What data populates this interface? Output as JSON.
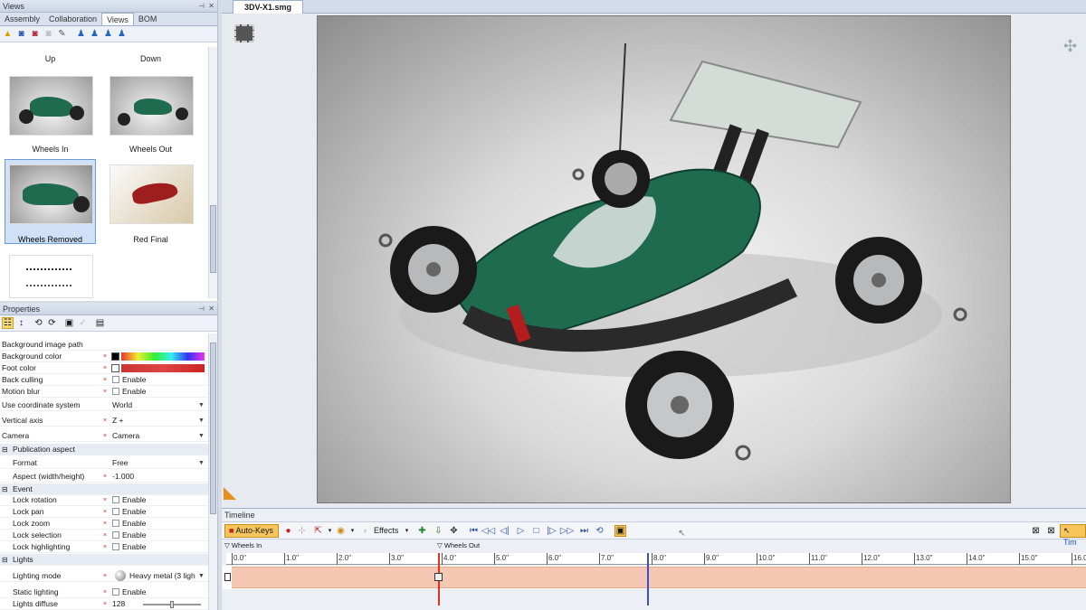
{
  "views_panel": {
    "title": "Views",
    "tabs": [
      "Assembly",
      "Collaboration",
      "Views",
      "BOM"
    ],
    "active_tab": "Views",
    "top_labels": [
      "Up",
      "Down"
    ],
    "thumbs": [
      {
        "label": "Wheels In"
      },
      {
        "label": "Wheels Out"
      },
      {
        "label": "Wheels Removed"
      },
      {
        "label": "Red Final"
      }
    ]
  },
  "document_tab": "3DV-X1.smg",
  "properties_panel": {
    "title": "Properties",
    "rows": [
      {
        "name": "Background image path",
        "value": ""
      },
      {
        "name": "Background color",
        "value": ""
      },
      {
        "name": "Foot color",
        "value": ""
      },
      {
        "name": "Back culling",
        "value": "Enable"
      },
      {
        "name": "Motion blur",
        "value": "Enable"
      },
      {
        "name": "Use coordinate system",
        "value": "World"
      },
      {
        "name": "Vertical axis",
        "value": "Z +"
      },
      {
        "name": "Camera",
        "value": "Camera"
      },
      {
        "name": "Publication aspect",
        "value": ""
      },
      {
        "name": "Format",
        "value": "Free"
      },
      {
        "name": "Aspect (width/height)",
        "value": "-1.000"
      },
      {
        "name": "Event",
        "value": ""
      },
      {
        "name": "Lock rotation",
        "value": "Enable"
      },
      {
        "name": "Lock pan",
        "value": "Enable"
      },
      {
        "name": "Lock zoom",
        "value": "Enable"
      },
      {
        "name": "Lock selection",
        "value": "Enable"
      },
      {
        "name": "Lock highlighting",
        "value": "Enable"
      },
      {
        "name": "Lights",
        "value": ""
      },
      {
        "name": "Lighting mode",
        "value": "Heavy metal (3 ligh"
      },
      {
        "name": "Static lighting",
        "value": "Enable"
      },
      {
        "name": "Lights diffuse",
        "value": "128"
      }
    ]
  },
  "timeline": {
    "title": "Timeline",
    "auto_keys": "Auto-Keys",
    "effects": "Effects",
    "right_label": "Tim",
    "markers": [
      "Wheels In",
      "Wheels Out"
    ],
    "ticks": [
      "0.0\"",
      "1.0\"",
      "2.0\"",
      "3.0\"",
      "4.0\"",
      "5.0\"",
      "6.0\"",
      "7.0\"",
      "8.0\"",
      "9.0\"",
      "10.0\"",
      "11.0\"",
      "12.0\"",
      "13.0\"",
      "14.0\"",
      "15.0\"",
      "16.0\""
    ]
  },
  "colors": {
    "timeline_bar": "#f6c7b3",
    "playhead": "#e0331e",
    "cursor_line": "#3a4fd0",
    "car_body": "#1f6b4f"
  }
}
